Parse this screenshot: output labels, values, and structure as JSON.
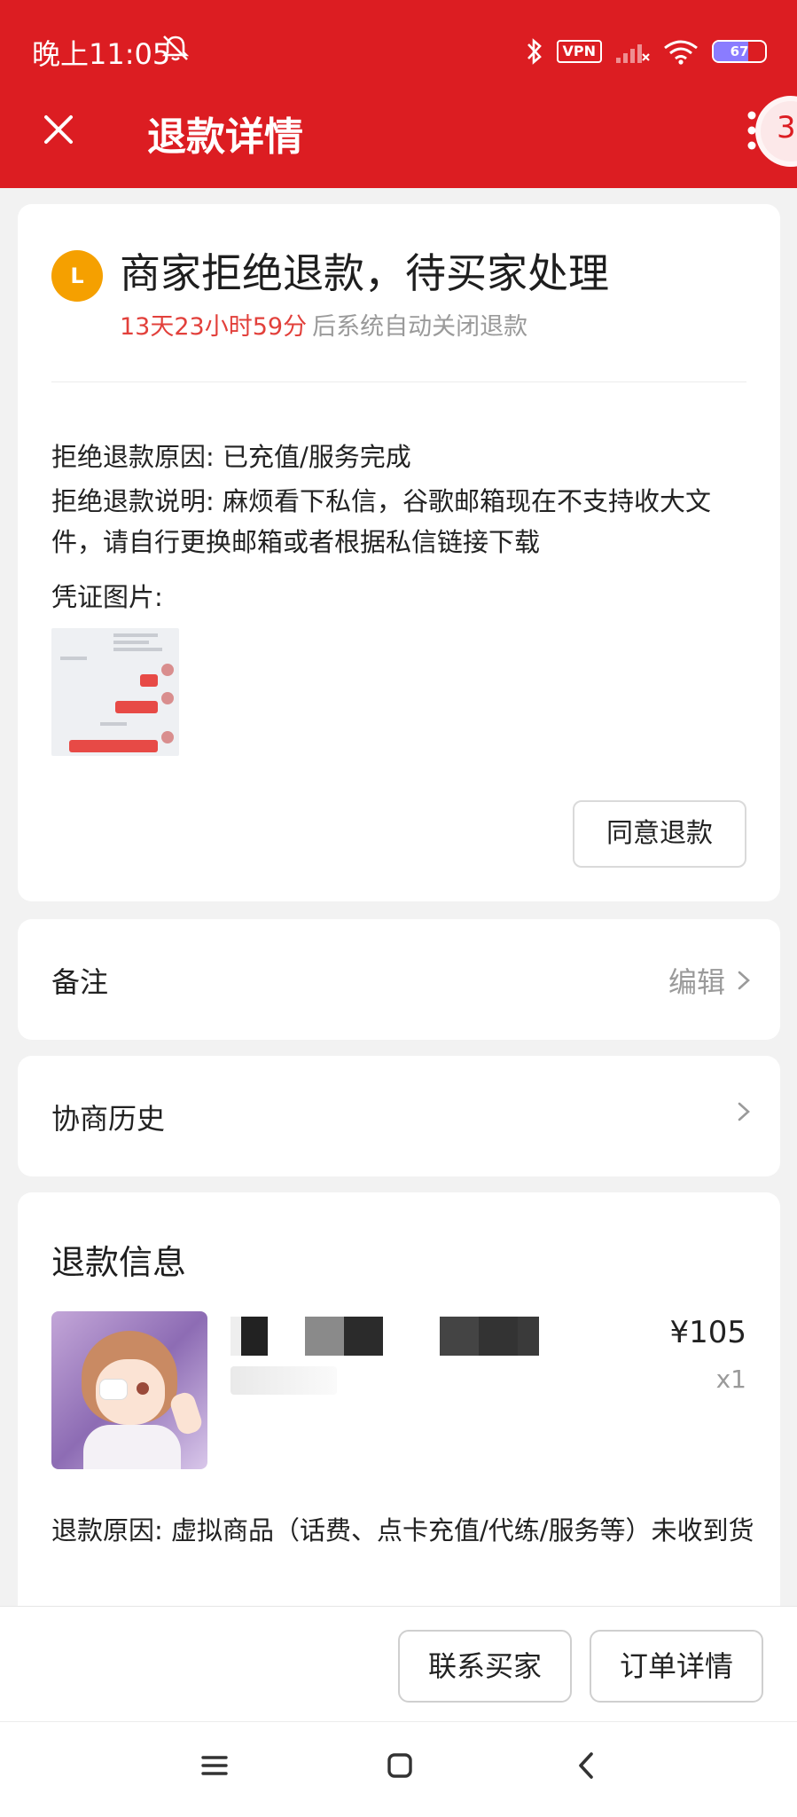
{
  "status_bar": {
    "time": "晚上11:05",
    "vpn": "VPN",
    "battery": "67",
    "battery_level": 0.67
  },
  "header": {
    "title": "退款详情",
    "float_badge": "3"
  },
  "status_card": {
    "badge": "L",
    "title": "商家拒绝退款，待买家处理",
    "countdown": "13天23小时59分",
    "countdown_suffix": "后系统自动关闭退款",
    "reject_reason": "拒绝退款原因: 已充值/服务完成",
    "reject_desc": "拒绝退款说明: 麻烦看下私信，谷歌邮箱现在不支持收大文件，请自行更换邮箱或者根据私信链接下载",
    "proof_label": "凭证图片:",
    "agree_button": "同意退款"
  },
  "note_row": {
    "label": "备注",
    "action": "编辑"
  },
  "history_row": {
    "label": "协商历史"
  },
  "refund_info": {
    "title": "退款信息",
    "price": "¥105",
    "quantity": "x1",
    "reason": "退款原因: 虚拟商品（话费、点卡充值/代练/服务等）未收到货"
  },
  "actions": {
    "contact_buyer": "联系买家",
    "order_detail": "订单详情"
  },
  "colors": {
    "brand_red": "#dc1d22",
    "countdown": "#e2403b",
    "status_dot": "#f5a000"
  },
  "icons": {
    "close": "close-icon",
    "more": "more-vertical-icon",
    "chevron": "chevron-right-icon",
    "nav_menu": "menu-icon",
    "nav_home": "home-square-icon",
    "nav_back": "back-arrow-icon"
  }
}
